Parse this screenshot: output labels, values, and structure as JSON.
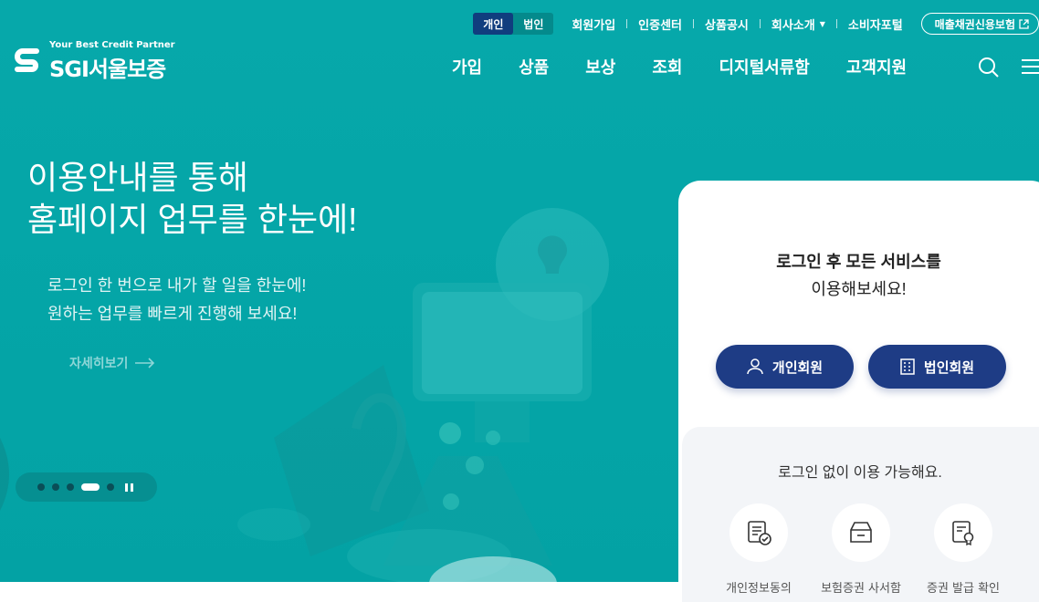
{
  "header": {
    "segment": [
      {
        "label": "개인",
        "active": true
      },
      {
        "label": "법인",
        "active": false
      }
    ],
    "util_links": [
      "회원가입",
      "인증센터",
      "상품공시",
      "회사소개",
      "소비자포털"
    ],
    "util_pill": "매출채권신용보험",
    "logo_tagline": "Your Best Credit Partner",
    "logo_name": "SGI서울보증",
    "gnb": [
      "가입",
      "상품",
      "보상",
      "조회",
      "디지털서류함",
      "고객지원"
    ]
  },
  "hero": {
    "title_line1": "이용안내를 통해",
    "title_line2": "홈페이지 업무를 한눈에!",
    "sub_line1": "로그인 한 번으로 내가 할 일을 한눈에!",
    "sub_line2": "원하는 업무를 빠르게 진행해 보세요!",
    "more": "자세히보기",
    "slides_total": 6,
    "slide_active": 4
  },
  "panel": {
    "title_line1": "로그인 후 모든 서비스를",
    "title_line2": "이용해보세요!",
    "btn_person": "개인회원",
    "btn_corp": "법인회원",
    "guest_title": "로그인 없이 이용 가능해요.",
    "services": [
      {
        "label": "개인정보동의",
        "icon": "document-check-icon"
      },
      {
        "label": "보험증권 사서함",
        "icon": "mailbox-icon"
      },
      {
        "label": "증권 발급 확인",
        "icon": "certificate-icon"
      }
    ]
  },
  "colors": {
    "bg": "#04a5a7",
    "navy": "#1e3c85",
    "segment_active": "#103d7e"
  }
}
